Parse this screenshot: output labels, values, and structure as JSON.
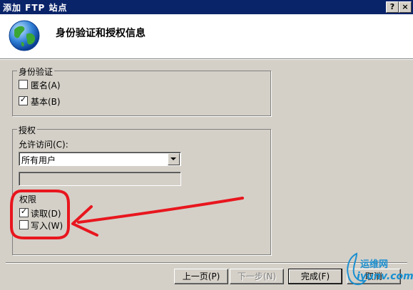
{
  "window": {
    "title": "添加 FTP 站点",
    "help_glyph": "?",
    "close_glyph": "×"
  },
  "header": {
    "title": "身份验证和授权信息",
    "icon": "globe-icon"
  },
  "authentication": {
    "legend": "身份验证",
    "anonymous": {
      "label": "匿名(A)",
      "checked": false
    },
    "basic": {
      "label": "基本(B)",
      "checked": true
    }
  },
  "authorization": {
    "legend": "授权",
    "allow_access_label": "允许访问(C):",
    "allow_access_value": "所有用户",
    "extra_value": "",
    "permissions": {
      "legend": "权限",
      "read": {
        "label": "读取(D)",
        "checked": true
      },
      "write": {
        "label": "写入(W)",
        "checked": false
      }
    }
  },
  "check_glyph": "✓",
  "buttons": {
    "back": "上一页(P)",
    "next": "下一步(N)",
    "finish": "完成(F)",
    "cancel": "取消"
  },
  "watermark": {
    "line1": "运维网",
    "line2": "iyunv.com"
  },
  "colors": {
    "titlebar": "#0a246a",
    "annotation": "#e8161e",
    "watermark": "#1a8fd0"
  }
}
